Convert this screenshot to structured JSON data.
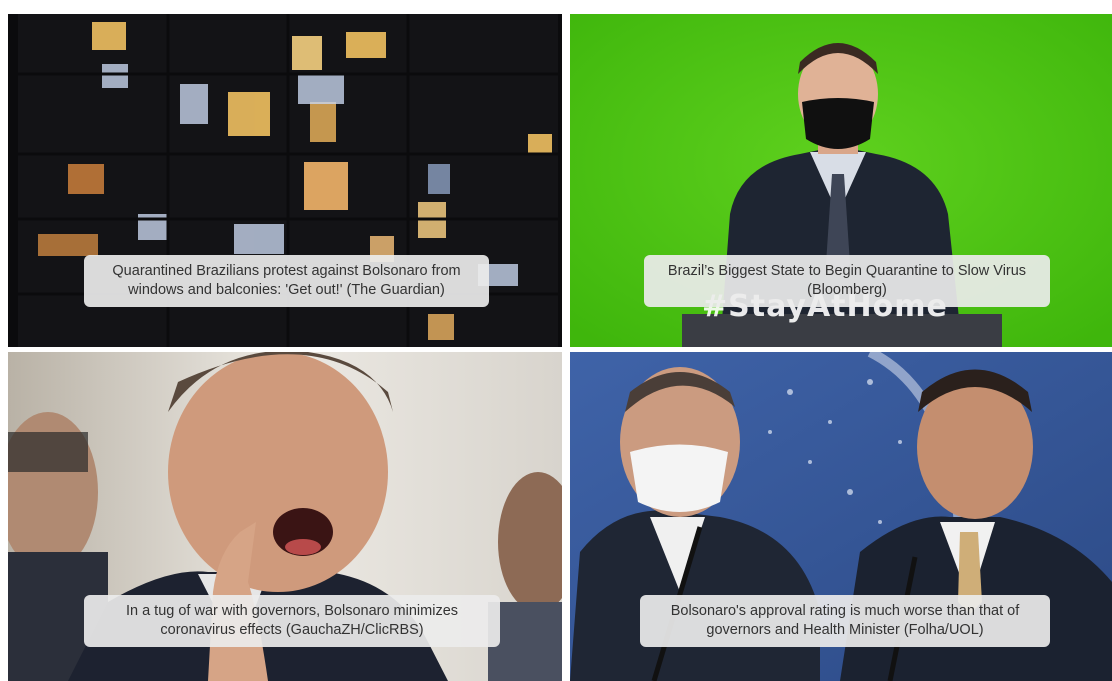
{
  "panels": [
    {
      "scene": "apartment-building-at-night",
      "caption": {
        "line1": "Quarantined Brazilians protest against Bolsonaro from",
        "line2": "windows and balconies: 'Get out!' (The Guardian)"
      }
    },
    {
      "scene": "masked-man-green-screen",
      "caption": {
        "line1": "Brazil’s Biggest State to Begin Quarantine to Slow Virus",
        "line2": "(Bloomberg)"
      },
      "hashtag": "#StayAtHome"
    },
    {
      "scene": "shouting-man-pointing",
      "caption": {
        "line1": "In a tug of war with governors, Bolsonaro minimizes",
        "line2": "coronavirus effects (GauchaZH/ClicRBS)"
      }
    },
    {
      "scene": "two-men-at-press-conference",
      "caption": {
        "line1": "Bolsonaro's approval rating is much worse than that of",
        "line2": "governors and Health Minister (Folha/UOL)"
      }
    }
  ]
}
